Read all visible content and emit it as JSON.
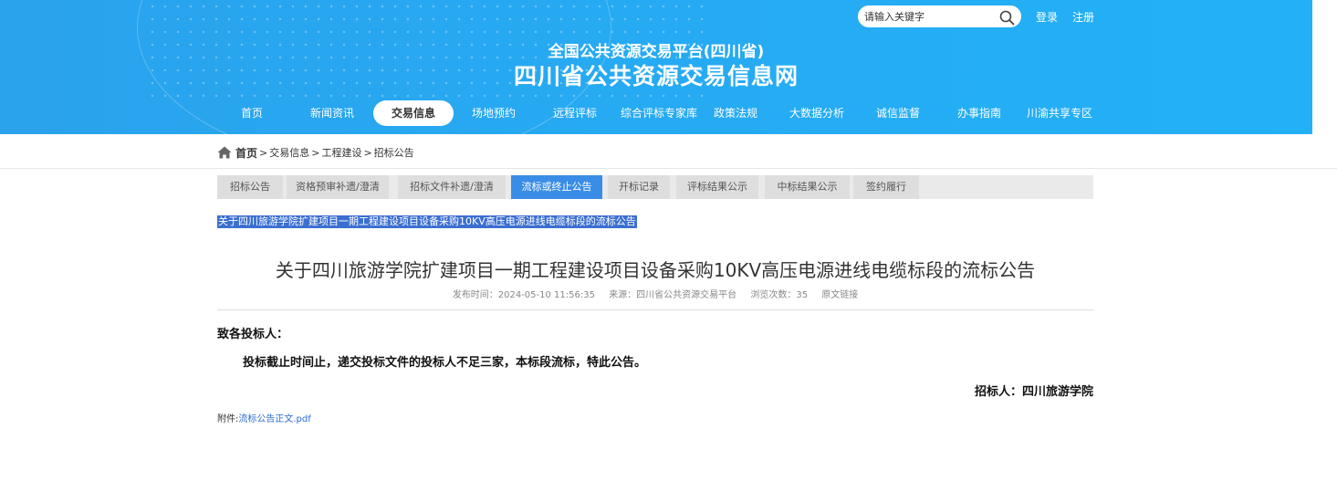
{
  "header": {
    "search_placeholder": "请输入关键字",
    "login": "登录",
    "register": "注册",
    "platform_subtitle": "全国公共资源交易平台(四川省)",
    "site_title": "四川省公共资源交易信息网",
    "bg_color": "#27a9f2"
  },
  "nav": {
    "items": [
      "首页",
      "新闻资讯",
      "交易信息",
      "场地预约",
      "远程评标",
      "综合评标专家库",
      "政策法规",
      "大数据分析",
      "诚信监督",
      "办事指南",
      "川渝共享专区"
    ],
    "active": "交易信息"
  },
  "breadcrumb": {
    "home": "首页",
    "sep": ">",
    "items": [
      "交易信息",
      "工程建设",
      "招标公告"
    ]
  },
  "tabs": {
    "items": [
      "招标公告",
      "资格预审补遗/澄清",
      "招标文件补遗/澄清",
      "流标或终止公告",
      "开标记录",
      "评标结果公示",
      "中标结果公示",
      "签约履行"
    ],
    "active": "流标或终止公告",
    "active_color": "#3a8de6"
  },
  "article": {
    "selected_title": "关于四川旅游学院扩建项目一期工程建设项目设备采购10KV高压电源进线电缆标段的流标公告",
    "title": "关于四川旅游学院扩建项目一期工程建设项目设备采购10KV高压电源进线电缆标段的流标公告",
    "publish_label": "发布时间：",
    "publish_time": "2024-05-10 11:56:35",
    "source_label": "来源：",
    "source": "四川省公共资源交易平台",
    "views_label": "浏览次数：",
    "views": "35",
    "original_link": "原文链接",
    "greeting": "致各投标人：",
    "content": "投标截止时间止，递交投标文件的投标人不足三家，本标段流标，特此公告。",
    "signer": "招标人：四川旅游学院",
    "attachment_label": "附件:",
    "attachment_file": "流标公告正文.pdf"
  }
}
